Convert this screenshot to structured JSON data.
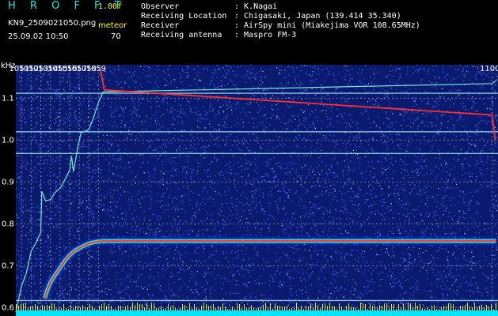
{
  "header": {
    "brand": "H R O F F T",
    "version": "1.00f",
    "filename": "KN9_2509021050.png",
    "meteor_label": "meteor",
    "meteor_count": "70",
    "datetime": "25.09.02 10:50",
    "info": [
      {
        "label": "Observer",
        "value": ": K.Nagai"
      },
      {
        "label": "Receiving Location",
        "value": ": Chigasaki, Japan (139.414 35.340)"
      },
      {
        "label": "Receiver",
        "value": ": AirSpy mini (Miakejima VOR 108.65MHz)"
      },
      {
        "label": "Receiving antenna",
        "value": ": Maspro FM-3"
      }
    ]
  },
  "colors": {
    "background": "#0a1a6e",
    "noise": "#4a64ff",
    "grid": "#9aa0a8",
    "text_yellow": "#ffff00",
    "brand_cyan": "#18e6e6",
    "trace": "#6fe8d8",
    "hot": "#ff3030",
    "bottom_bar": "#00e5ff"
  },
  "chart_data": {
    "type": "heatmap",
    "ylabel": "kHz",
    "ylim": [
      0.58,
      1.18
    ],
    "xlim": [
      1050.4,
      1100.6
    ],
    "x_ticks": [
      1051,
      1052,
      1053,
      1054,
      1055,
      1056,
      1057,
      1058,
      1059,
      1100
    ],
    "x_tick_labels": [
      "1051",
      "1052",
      "1053",
      "1054",
      "1055",
      "1056",
      "1057",
      "1058",
      "1059",
      "1100"
    ],
    "y_ticks": [
      0.6,
      0.7,
      0.8,
      0.9,
      1.0,
      1.1
    ],
    "y_tick_labels": [
      "0.6",
      "0.7",
      "0.8",
      "0.9",
      "1.0",
      "1.1"
    ],
    "grid": true,
    "horizontal_lines": [
      1.112,
      1.02,
      0.968,
      0.617
    ],
    "series": [
      {
        "x": [
          1050.4,
          1051.0,
          1051.5,
          1052.0,
          1052.5,
          1053.0,
          1053.1,
          1053.5,
          1054.0,
          1054.5,
          1055.0,
          1055.5,
          1056.0,
          1056.2,
          1056.4,
          1056.6,
          1056.9,
          1057.2,
          1057.5,
          1058.0,
          1058.5,
          1059.0,
          1059.5,
          1100.0,
          1100.4
        ],
        "y": [
          0.59,
          0.652,
          0.683,
          0.735,
          0.755,
          0.78,
          0.878,
          0.855,
          0.858,
          0.875,
          0.885,
          0.905,
          0.928,
          0.962,
          0.925,
          0.95,
          0.99,
          1.018,
          1.02,
          1.025,
          1.055,
          1.09,
          1.115,
          1.135,
          1.142
        ]
      },
      {
        "x": [
          1053.4,
          1053.7,
          1054.0,
          1054.5,
          1055.0,
          1055.5,
          1056.0,
          1056.5,
          1057.0,
          1057.5,
          1058.0,
          1058.5,
          1059.0,
          1059.5,
          1100.0,
          1100.4
        ],
        "y": [
          0.622,
          0.643,
          0.66,
          0.678,
          0.695,
          0.712,
          0.725,
          0.735,
          0.742,
          0.748,
          0.753,
          0.756,
          0.758,
          0.759,
          0.759,
          0.759
        ]
      },
      {
        "x": [
          1059.2,
          1059.6,
          1100.0,
          1100.3
        ],
        "y": [
          1.17,
          1.12,
          1.06,
          1.0
        ]
      }
    ]
  }
}
